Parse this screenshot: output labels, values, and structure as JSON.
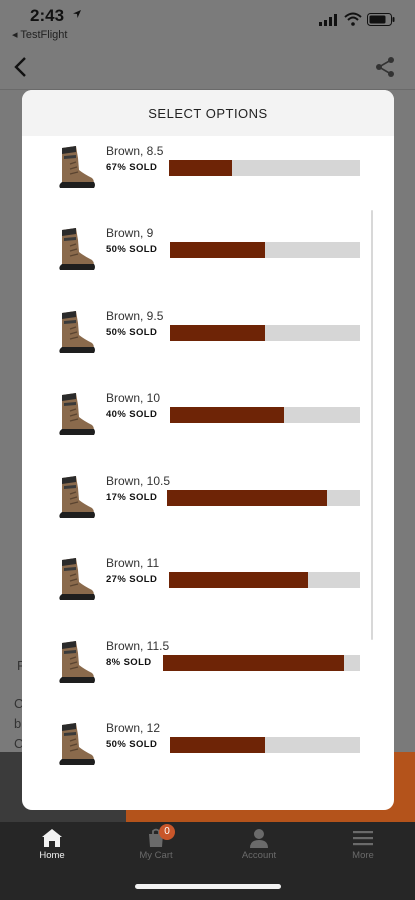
{
  "status_bar": {
    "time": "2:43",
    "back_app": "◂ TestFlight"
  },
  "background": {
    "line1": "F",
    "line2": "C",
    "line3": "b",
    "line4": "C"
  },
  "modal": {
    "title": "SELECT OPTIONS",
    "options": [
      {
        "name": "Brown, 8.5",
        "sold_label": "67% SOLD",
        "fill_fraction": 0.33
      },
      {
        "name": "Brown, 9",
        "sold_label": "50% SOLD",
        "fill_fraction": 0.5
      },
      {
        "name": "Brown, 9.5",
        "sold_label": "50% SOLD",
        "fill_fraction": 0.5
      },
      {
        "name": "Brown, 10",
        "sold_label": "40% SOLD",
        "fill_fraction": 0.6
      },
      {
        "name": "Brown, 10.5",
        "sold_label": "17% SOLD",
        "fill_fraction": 0.83
      },
      {
        "name": "Brown, 11",
        "sold_label": "27% SOLD",
        "fill_fraction": 0.73
      },
      {
        "name": "Brown, 11.5",
        "sold_label": "8% SOLD",
        "fill_fraction": 0.92
      },
      {
        "name": "Brown, 12",
        "sold_label": "50% SOLD",
        "fill_fraction": 0.5
      }
    ]
  },
  "tab_bar": {
    "tabs": [
      {
        "label": "Home",
        "icon": "home-icon",
        "active": true
      },
      {
        "label": "My Cart",
        "icon": "cart-icon",
        "badge": "0",
        "active": false
      },
      {
        "label": "Account",
        "icon": "person-icon",
        "active": false
      },
      {
        "label": "More",
        "icon": "menu-icon",
        "active": false
      }
    ]
  },
  "colors": {
    "bar_fill": "#6e2406",
    "bar_track": "#d6d6d6",
    "accent_orange": "#b4531b",
    "badge": "#c8562a"
  }
}
